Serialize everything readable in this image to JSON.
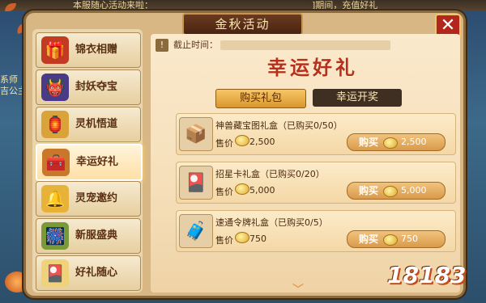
{
  "background": {
    "top_text_left": "本服随心活动来啦：",
    "top_text_right": "]期间，充值好礼",
    "left_text": [
      "系师",
      "吉公主"
    ]
  },
  "panel": {
    "title": "金秋活动",
    "close_symbol": "✕"
  },
  "sidebar": {
    "items": [
      {
        "label": "锦衣相赠",
        "icon": "chest-icon",
        "glyph": "🎁",
        "active": false
      },
      {
        "label": "封妖夺宝",
        "icon": "demon-icon",
        "glyph": "👹",
        "active": false
      },
      {
        "label": "灵机悟道",
        "icon": "medal-icon",
        "glyph": "🏮",
        "active": false
      },
      {
        "label": "幸运好礼",
        "icon": "treasure-chest-icon",
        "glyph": "🧰",
        "active": true
      },
      {
        "label": "灵宠邀约",
        "icon": "bell-icon",
        "glyph": "🔔",
        "active": false
      },
      {
        "label": "新服盛典",
        "icon": "gift-pile-icon",
        "glyph": "🎆",
        "active": false
      },
      {
        "label": "好礼随心",
        "icon": "card-icon",
        "glyph": "🎴",
        "active": false
      }
    ]
  },
  "content": {
    "deadline_icon": "!",
    "deadline_label": "截止时间：",
    "banner_title": "幸运好礼",
    "tabs": [
      {
        "label": "购买礼包",
        "active": true
      },
      {
        "label": "幸运开奖",
        "active": false
      }
    ],
    "price_label": "售价",
    "buy_label": "购买",
    "gifts": [
      {
        "name": "神兽藏宝图礼盒（已购买0/50）",
        "price": "2,500",
        "buy_price": "2,500",
        "glyph": "📦"
      },
      {
        "name": "招星卡礼盒（已购买0/20）",
        "price": "5,000",
        "buy_price": "5,000",
        "glyph": "🎴"
      },
      {
        "name": "速通令牌礼盒（已购买0/5）",
        "price": "750",
        "buy_price": "750",
        "glyph": "🧳"
      }
    ],
    "scroll_symbol": "﹀"
  },
  "watermark": "18183"
}
